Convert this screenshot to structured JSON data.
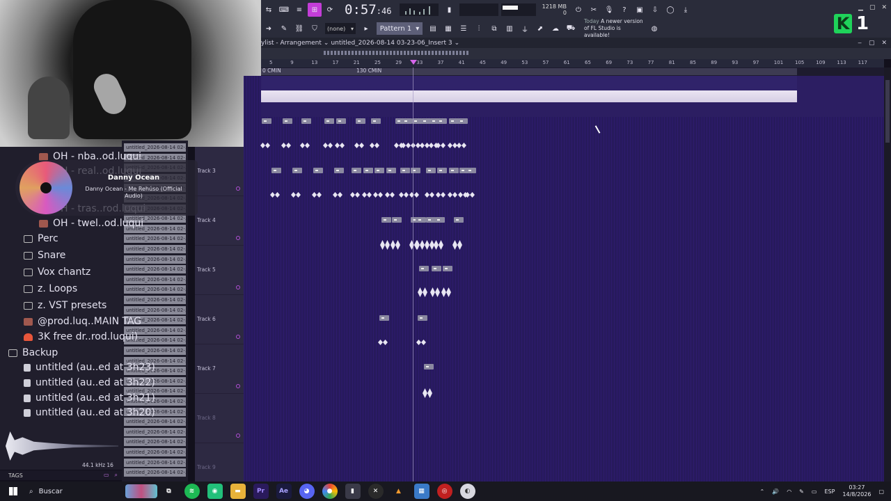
{
  "toolbar": {
    "time_main": "0:57",
    "time_frac": "46",
    "time_unit": "M:S:CS",
    "cpu_value": "40",
    "mem_value": "1218 MB",
    "mem_sub": "0",
    "none_select": "(none)",
    "pattern_select": "Pattern 1",
    "news_today": "Today",
    "news_text": "A newer version of FL Studio is available!"
  },
  "logo": {
    "letter": "K",
    "number": "1",
    "color": "#1fd35a"
  },
  "playlist": {
    "title": "ylist - Arrangement",
    "file": "untitled_2026-08-14 03-23-06_Insert 3",
    "ruler": [
      "5",
      "9",
      "13",
      "17",
      "21",
      "25",
      "29",
      "33",
      "37",
      "41",
      "45",
      "49",
      "53",
      "57",
      "61",
      "65",
      "69",
      "73",
      "77",
      "81",
      "85",
      "89",
      "93",
      "97",
      "101",
      "105",
      "109",
      "113",
      "117"
    ],
    "markers": [
      {
        "label": "0 CMIN"
      },
      {
        "label": "130 CMIN"
      }
    ],
    "tracks": [
      {
        "label": "Track 3",
        "dim": false
      },
      {
        "label": "Track 4",
        "dim": false
      },
      {
        "label": "Track 5",
        "dim": false
      },
      {
        "label": "Track 6",
        "dim": false
      },
      {
        "label": "Track 7",
        "dim": false
      },
      {
        "label": "Track 8",
        "dim": true
      },
      {
        "label": "Track 9",
        "dim": true
      }
    ]
  },
  "now_playing": {
    "artist": "Danny Ocean",
    "song": "Danny Ocean - Me Rehúso (Official Audio)"
  },
  "browser": {
    "items": [
      {
        "label": "OH - nba..od.luqui",
        "icon": "audio",
        "indent": 2
      },
      {
        "label": "OH - real..od.luqui",
        "icon": "audio",
        "indent": 2
      },
      {
        "label": "OH - tras..rod.luqui",
        "icon": "audio",
        "indent": 2
      },
      {
        "label": "OH - twel..od.luqui",
        "icon": "audio",
        "indent": 2
      },
      {
        "label": "Perc",
        "icon": "folder",
        "indent": 1
      },
      {
        "label": "Snare",
        "icon": "folder",
        "indent": 1
      },
      {
        "label": "Vox chantz",
        "icon": "folder",
        "indent": 1
      },
      {
        "label": "z. Loops",
        "icon": "folder",
        "indent": 1
      },
      {
        "label": "z. VST presets",
        "icon": "folder",
        "indent": 1
      },
      {
        "label": "@prod.luq..MAIN TAG",
        "icon": "audio",
        "indent": 1
      },
      {
        "label": "3K free dr..rod.luqui)",
        "icon": "fire",
        "indent": 1
      },
      {
        "label": "Backup",
        "icon": "folder",
        "indent": 0
      },
      {
        "label": "untitled (au..ed at 3h23)",
        "icon": "doc",
        "indent": 1
      },
      {
        "label": "untitled (au..ed at 3h22)",
        "icon": "doc",
        "indent": 1
      },
      {
        "label": "untitled (au..ed at 3h21)",
        "icon": "doc",
        "indent": 1
      },
      {
        "label": "untitled (au..ed at 3h20)",
        "icon": "doc",
        "indent": 1
      }
    ],
    "sample_rate": "44.1 kHz 16",
    "tags_label": "TAGS"
  },
  "clip_name": "untitled_2026-08-14 02-...",
  "taskbar": {
    "search": "Buscar",
    "lang": "ESP",
    "time": "03:27",
    "date": "14/8/2026"
  }
}
